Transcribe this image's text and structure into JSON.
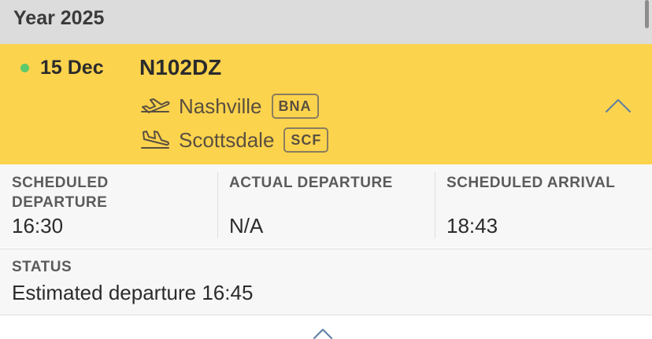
{
  "year_header": {
    "label": "Year 2025"
  },
  "flight": {
    "date": "15 Dec",
    "tail_number": "N102DZ",
    "origin": {
      "city": "Nashville",
      "code": "BNA"
    },
    "destination": {
      "city": "Scottsdale",
      "code": "SCF"
    },
    "status_dot_color": "#5cc96b",
    "card_color": "#fcd34d"
  },
  "times": [
    {
      "label": "SCHEDULED DEPARTURE",
      "value": "16:30"
    },
    {
      "label": "ACTUAL DEPARTURE",
      "value": "N/A"
    },
    {
      "label": "SCHEDULED ARRIVAL",
      "value": "18:43"
    }
  ],
  "status": {
    "label": "STATUS",
    "value": "Estimated departure 16:45"
  },
  "icons": {
    "origin": "plane-takeoff-icon",
    "destination": "plane-landing-icon",
    "collapse": "chevron-up-icon"
  }
}
